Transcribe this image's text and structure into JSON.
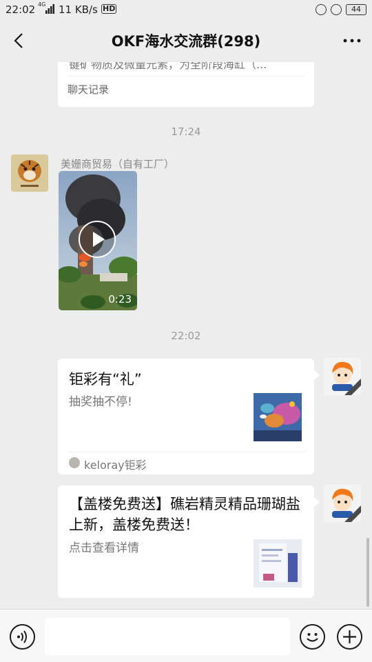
{
  "status_bar": {
    "time": "22:02",
    "network": "4G",
    "speed": "11 KB/s",
    "hd": "HD",
    "battery": "44"
  },
  "header": {
    "title": "OKF海水交流群(298)"
  },
  "messages": {
    "prev_card": {
      "text": "键矿物质及微量元素，为全阶段海缸（...",
      "footer": "聊天记录"
    },
    "time1": "17:24",
    "video_msg": {
      "sender": "美姗商贸易（自有工厂）",
      "duration": "0:23"
    },
    "time2": "22:02",
    "link1": {
      "title": "钜彩有“礼”",
      "desc": "抽奖抽不停!",
      "source": "keloray钜彩"
    },
    "link2": {
      "title": "【盖楼免费送】礁岩精灵精品珊瑚盐上新，盖楼免费送！",
      "desc": "点击查看详情"
    }
  },
  "icons": {
    "back": "chevron-left-icon",
    "more": "more-icon",
    "voice": "voice-icon",
    "emoji": "emoji-icon",
    "plus": "plus-icon"
  }
}
